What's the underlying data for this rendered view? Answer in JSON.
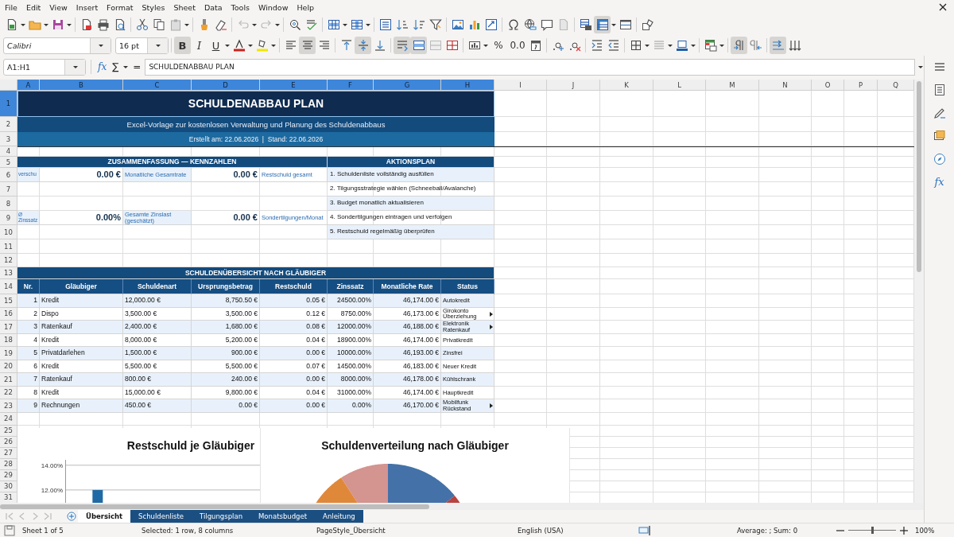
{
  "menu": [
    "File",
    "Edit",
    "View",
    "Insert",
    "Format",
    "Styles",
    "Sheet",
    "Data",
    "Tools",
    "Window",
    "Help"
  ],
  "view_toggles": [
    {
      "kind": "freeze",
      "on": true
    }
  ],
  "font": {
    "name": "Calibri",
    "size": "16 pt"
  },
  "text_toggles": [
    {
      "kind": "bold",
      "label": "B",
      "on": true
    },
    {
      "kind": "italic",
      "label": "I",
      "on": false
    },
    {
      "kind": "underline",
      "label": "U",
      "on": false
    }
  ],
  "align_toggles": [
    {
      "kind": "align-left",
      "on": false
    },
    {
      "kind": "align-center",
      "on": true
    },
    {
      "kind": "align-right",
      "on": false
    },
    {
      "kind": "align-top",
      "on": false
    },
    {
      "kind": "align-middle",
      "on": true
    },
    {
      "kind": "align-bottom",
      "on": false
    },
    {
      "kind": "wrap-text",
      "on": true
    },
    {
      "kind": "merge-center",
      "on": true
    },
    {
      "kind": "merge-cells",
      "on": false
    },
    {
      "kind": "unmerge-cells",
      "on": false
    }
  ],
  "number_labels": [
    "%",
    "0.0"
  ],
  "direction_toggles": [
    {
      "kind": "left-to-right",
      "on": true
    },
    {
      "kind": "right-to-left",
      "on": false
    },
    {
      "kind": "text-flow",
      "on": true
    },
    {
      "kind": "vertical-text",
      "on": false
    }
  ],
  "formula_bar": {
    "name_box": "A1:H1",
    "wizard": "fx",
    "sum": "∑",
    "equals": "=",
    "formula": "SCHULDENABBAU PLAN"
  },
  "columns": [
    {
      "label": "A",
      "selected": true
    },
    {
      "label": "B",
      "selected": true
    },
    {
      "label": "C",
      "selected": true
    },
    {
      "label": "D",
      "selected": true
    },
    {
      "label": "E",
      "selected": true
    },
    {
      "label": "F",
      "selected": true
    },
    {
      "label": "G",
      "selected": true
    },
    {
      "label": "H",
      "selected": true
    },
    {
      "label": "I",
      "selected": false
    },
    {
      "label": "J",
      "selected": false
    },
    {
      "label": "K",
      "selected": false
    },
    {
      "label": "L",
      "selected": false
    },
    {
      "label": "M",
      "selected": false
    },
    {
      "label": "N",
      "selected": false
    },
    {
      "label": "O",
      "selected": false
    },
    {
      "label": "P",
      "selected": false
    },
    {
      "label": "Q",
      "selected": false
    }
  ],
  "rows": [
    {
      "label": "1",
      "selected": true
    },
    {
      "label": "2",
      "selected": false
    },
    {
      "label": "3",
      "selected": false
    },
    {
      "label": "4",
      "selected": false
    },
    {
      "label": "5",
      "selected": false
    },
    {
      "label": "6",
      "selected": false
    },
    {
      "label": "7",
      "selected": false
    },
    {
      "label": "8",
      "selected": false
    },
    {
      "label": "9",
      "selected": false
    },
    {
      "label": "10",
      "selected": false
    },
    {
      "label": "11",
      "selected": false
    },
    {
      "label": "12",
      "selected": false
    },
    {
      "label": "13",
      "selected": false
    },
    {
      "label": "14",
      "selected": false
    },
    {
      "label": "15",
      "selected": false
    },
    {
      "label": "16",
      "selected": false
    },
    {
      "label": "17",
      "selected": false
    },
    {
      "label": "18",
      "selected": false
    },
    {
      "label": "19",
      "selected": false
    },
    {
      "label": "20",
      "selected": false
    },
    {
      "label": "21",
      "selected": false
    },
    {
      "label": "22",
      "selected": false
    },
    {
      "label": "23",
      "selected": false
    },
    {
      "label": "24",
      "selected": false
    },
    {
      "label": "25",
      "selected": false
    },
    {
      "label": "26",
      "selected": false
    },
    {
      "label": "27",
      "selected": false
    },
    {
      "label": "28",
      "selected": false
    },
    {
      "label": "29",
      "selected": false
    },
    {
      "label": "30",
      "selected": false
    },
    {
      "label": "31",
      "selected": false
    }
  ],
  "title": "SCHULDENABBAU PLAN",
  "subtitle": "Excel-Vorlage zur kostenlosen Verwaltung und Planung des Schuldenabbaus",
  "date_line": "Erstellt am: 22.06.2026  |  Stand: 22.06.2026",
  "summary": {
    "heading": "ZUSAMMENFASSUNG — KENNZAHLEN",
    "items": [
      {
        "label": "verschu",
        "value": "0.00 €"
      },
      {
        "label": "Monatliche Gesamtrate",
        "value": "0.00 €"
      },
      {
        "label": "Restschuld gesamt"
      },
      {
        "label": "Ø Zinssatz",
        "value": "0.00%"
      },
      {
        "label": "Gesamte Zinslast (geschätzt)",
        "value": "0.00 €"
      },
      {
        "label": "Sondertilgungen/Monat"
      }
    ]
  },
  "action_plan": {
    "heading": "AKTIONSPLAN",
    "items": [
      "1. Schuldenliste vollständig ausfüllen",
      "2. Tilgungsstrategie wählen (Schneeball/Avalanche)",
      "3. Budget monatlich aktualisieren",
      "4. Sondertilgungen eintragen und verfolgen",
      "5. Restschuld regelmäßig überprüfen"
    ]
  },
  "debts": {
    "heading": "SCHULDENÜBERSICHT NACH GLÄUBIGER",
    "columns": [
      "Nr.",
      "Gläubiger",
      "Schuldenart",
      "Ursprungsbetrag",
      "Restschuld",
      "Zinssatz",
      "Monatliche Rate",
      "Status"
    ],
    "rows": [
      {
        "cells": [
          "1",
          "Kredit",
          "12,000.00 €",
          "8,750.50 €",
          "0.05 €",
          "24500.00%",
          "46,174.00 €",
          "Autokredit"
        ],
        "overflow": false
      },
      {
        "cells": [
          "2",
          "Dispo",
          "3,500.00 €",
          "3,500.00 €",
          "0.12 €",
          "8750.00%",
          "46,173.00 €",
          "Girokonto Überziehung"
        ],
        "overflow": true
      },
      {
        "cells": [
          "3",
          "Ratenkauf",
          "2,400.00 €",
          "1,680.00 €",
          "0.08 €",
          "12000.00%",
          "46,188.00 €",
          "Elektronik Ratenkauf"
        ],
        "overflow": true
      },
      {
        "cells": [
          "4",
          "Kredit",
          "8,000.00 €",
          "5,200.00 €",
          "0.04 €",
          "18900.00%",
          "46,174.00 €",
          "Privatkredit"
        ],
        "overflow": false
      },
      {
        "cells": [
          "5",
          "Privatdarlehen",
          "1,500.00 €",
          "900.00 €",
          "0.00 €",
          "10000.00%",
          "46,193.00 €",
          "Zinsfrei"
        ],
        "overflow": false
      },
      {
        "cells": [
          "6",
          "Kredit",
          "5,500.00 €",
          "5,500.00 €",
          "0.07 €",
          "14500.00%",
          "46,183.00 €",
          "Neuer Kredit"
        ],
        "overflow": false
      },
      {
        "cells": [
          "7",
          "Ratenkauf",
          "800.00 €",
          "240.00 €",
          "0.00 €",
          "8000.00%",
          "46,178.00 €",
          "Kühlschrank"
        ],
        "overflow": false
      },
      {
        "cells": [
          "8",
          "Kredit",
          "15,000.00 €",
          "9,800.00 €",
          "0.04 €",
          "31000.00%",
          "46,174.00 €",
          "Hauptkredit"
        ],
        "overflow": false
      },
      {
        "cells": [
          "9",
          "Rechnungen",
          "450.00 €",
          "0.00 €",
          "0.00 €",
          "0.00%",
          "46,170.00 €",
          "Mobilfunk Rückstand"
        ],
        "overflow": true
      }
    ]
  },
  "charts": [
    {
      "chart_data": {
        "type": "bar",
        "title": "Restschuld je Gläubiger",
        "values": [
          null,
          12,
          null,
          null,
          null,
          null,
          null,
          null,
          null
        ],
        "ylim": [
          10,
          14.5
        ],
        "yticks": [
          {
            "value": 12,
            "label": "12.00%"
          },
          {
            "value": 14,
            "label": "14.00%"
          }
        ]
      }
    },
    {
      "title": "Schuldenverteilung nach Gläubiger"
    }
  ],
  "sheet_tabs": [
    {
      "label": "Übersicht",
      "selected": true
    },
    {
      "label": "Schuldenliste",
      "selected": false
    },
    {
      "label": "Tilgungsplan",
      "selected": false
    },
    {
      "label": "Monatsbudget",
      "selected": false
    },
    {
      "label": "Anleitung",
      "selected": false
    }
  ],
  "sidebar": {
    "function_label": "fx"
  },
  "status_bar": {
    "sheet": "Sheet 1 of 5",
    "selection": "Selected: 1 row, 8 columns",
    "page_style": "PageStyle_Übersicht",
    "language": "English (USA)",
    "sum": "Average: ; Sum: 0",
    "zoom": {
      "level": 0.5,
      "reading": "100%"
    }
  }
}
